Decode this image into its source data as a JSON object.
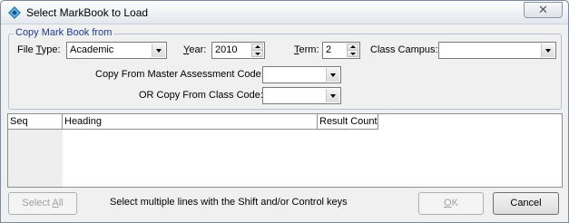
{
  "window": {
    "title": "Select MarkBook to Load",
    "close_label": "✕"
  },
  "group": {
    "title": "Copy Mark Book from"
  },
  "fields": {
    "file_type": {
      "label_pre": "File ",
      "label_u": "T",
      "label_post": "ype:",
      "value": "Academic"
    },
    "year": {
      "label_u": "Y",
      "label_post": "ear:",
      "value": "2010"
    },
    "term": {
      "label_u": "T",
      "label_post": "erm:",
      "value": "2"
    },
    "class_campus": {
      "label": "Class Campus:",
      "value": ""
    },
    "master_code": {
      "label": "Copy From Master Assessment Code:",
      "value": ""
    },
    "class_code": {
      "label": "OR  Copy From Class Code:",
      "value": ""
    }
  },
  "grid": {
    "columns": [
      "Seq",
      "Heading",
      "Result Count"
    ]
  },
  "footer": {
    "select_all_pre": "Select ",
    "select_all_u": "A",
    "select_all_post": "ll",
    "hint": "Select multiple lines with the Shift and/or Control keys",
    "ok_u": "O",
    "ok_post": "K",
    "cancel": "Cancel"
  }
}
